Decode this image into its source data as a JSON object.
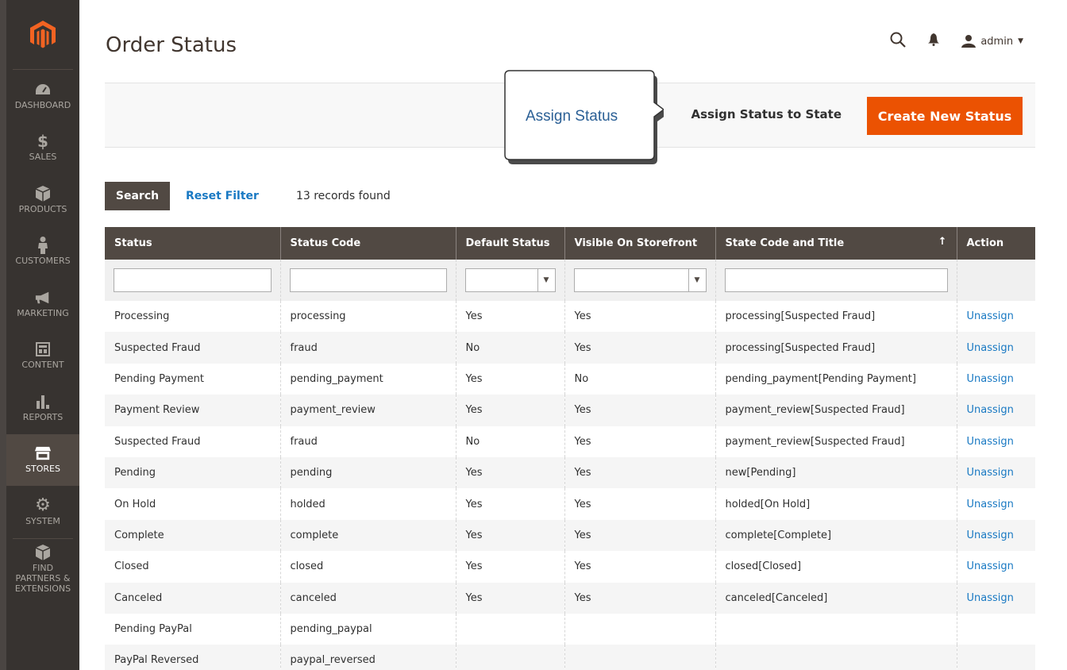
{
  "page": {
    "title": "Order Status"
  },
  "header": {
    "user": "admin"
  },
  "sidebar": {
    "items": [
      {
        "label": "DASHBOARD"
      },
      {
        "label": "SALES"
      },
      {
        "label": "PRODUCTS"
      },
      {
        "label": "CUSTOMERS"
      },
      {
        "label": "MARKETING"
      },
      {
        "label": "CONTENT"
      },
      {
        "label": "REPORTS"
      },
      {
        "label": "STORES"
      },
      {
        "label": "SYSTEM"
      },
      {
        "label": "FIND PARTNERS & EXTENSIONS"
      }
    ]
  },
  "actions": {
    "assign_label": "Assign Status to State",
    "create_label": "Create New Status"
  },
  "callout": {
    "text": "Assign Status"
  },
  "toolbar": {
    "search_label": "Search",
    "reset_label": "Reset Filter",
    "records": "13 records found"
  },
  "grid": {
    "columns": [
      "Status",
      "Status Code",
      "Default Status",
      "Visible On Storefront",
      "State Code and Title",
      "Action"
    ],
    "sort_indicator": "↑",
    "rows": [
      {
        "status": "Processing",
        "code": "processing",
        "default": "Yes",
        "visible": "Yes",
        "state": "processing[Suspected Fraud]",
        "action": "Unassign"
      },
      {
        "status": "Suspected Fraud",
        "code": "fraud",
        "default": "No",
        "visible": "Yes",
        "state": "processing[Suspected Fraud]",
        "action": "Unassign"
      },
      {
        "status": "Pending Payment",
        "code": "pending_payment",
        "default": "Yes",
        "visible": "No",
        "state": "pending_payment[Pending Payment]",
        "action": "Unassign"
      },
      {
        "status": "Payment Review",
        "code": "payment_review",
        "default": "Yes",
        "visible": "Yes",
        "state": "payment_review[Suspected Fraud]",
        "action": "Unassign"
      },
      {
        "status": "Suspected Fraud",
        "code": "fraud",
        "default": "No",
        "visible": "Yes",
        "state": "payment_review[Suspected Fraud]",
        "action": "Unassign"
      },
      {
        "status": "Pending",
        "code": "pending",
        "default": "Yes",
        "visible": "Yes",
        "state": "new[Pending]",
        "action": "Unassign"
      },
      {
        "status": "On Hold",
        "code": "holded",
        "default": "Yes",
        "visible": "Yes",
        "state": "holded[On Hold]",
        "action": "Unassign"
      },
      {
        "status": "Complete",
        "code": "complete",
        "default": "Yes",
        "visible": "Yes",
        "state": "complete[Complete]",
        "action": "Unassign"
      },
      {
        "status": "Closed",
        "code": "closed",
        "default": "Yes",
        "visible": "Yes",
        "state": "closed[Closed]",
        "action": "Unassign"
      },
      {
        "status": "Canceled",
        "code": "canceled",
        "default": "Yes",
        "visible": "Yes",
        "state": "canceled[Canceled]",
        "action": "Unassign"
      },
      {
        "status": "Pending PayPal",
        "code": "pending_paypal",
        "default": "",
        "visible": "",
        "state": "",
        "action": ""
      },
      {
        "status": "PayPal Reversed",
        "code": "paypal_reversed",
        "default": "",
        "visible": "",
        "state": "",
        "action": ""
      }
    ]
  },
  "colors": {
    "accent": "#eb5202",
    "sidebar": "#373330",
    "header_row": "#514943",
    "link": "#1979c3",
    "callout_text": "#2a5f95"
  }
}
